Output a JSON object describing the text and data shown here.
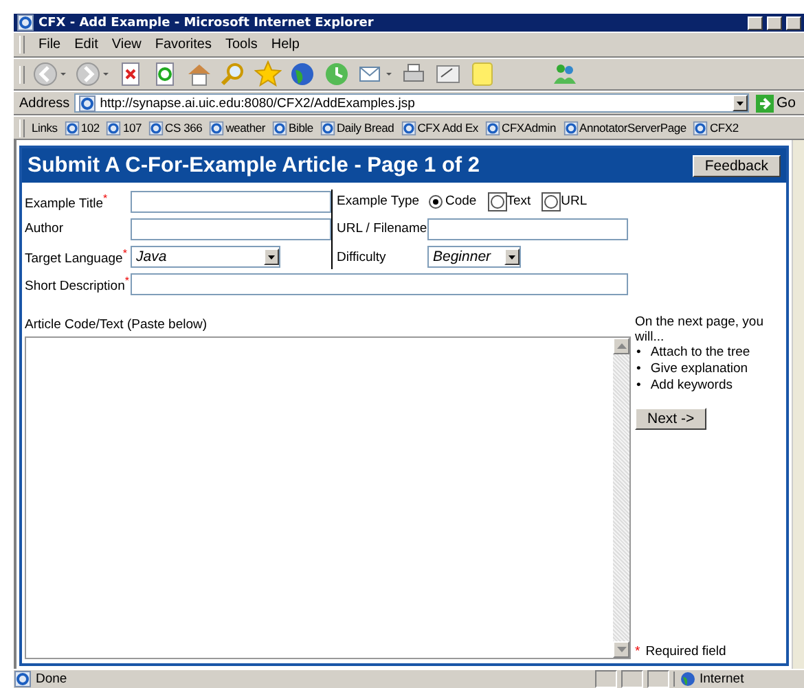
{
  "window": {
    "title": "CFX - Add Example - Microsoft Internet Explorer"
  },
  "menu": [
    "File",
    "Edit",
    "View",
    "Favorites",
    "Tools",
    "Help"
  ],
  "address": {
    "label": "Address",
    "url": "http://synapse.ai.uic.edu:8080/CFX2/AddExamples.jsp",
    "go": "Go"
  },
  "links": {
    "label": "Links",
    "items": [
      "102",
      "107",
      "CS 366",
      "weather",
      "Bible",
      "Daily Bread",
      "CFX Add Ex",
      "CFXAdmin",
      "AnnotatorServerPage",
      "CFX2"
    ]
  },
  "page": {
    "heading": "Submit A C-For-Example Article - Page 1 of 2",
    "feedback": "Feedback"
  },
  "form": {
    "title": {
      "label": "Example Title$^{*}$"
    },
    "author": {
      "label": "Author"
    },
    "language": {
      "label": "Target Language$^{*}$",
      "value": "Java"
    },
    "type": {
      "label": "Example Type",
      "options": [
        {
          "label": "Code",
          "selected": true
        },
        {
          "label": "Text",
          "selected": false
        },
        {
          "label": "URL",
          "selected": false
        }
      ]
    },
    "url": {
      "label": "URL / Filename"
    },
    "difficulty": {
      "label": "Difficulty",
      "value": "Beginner"
    },
    "description": {
      "label": "Short Description$^{*}$"
    },
    "article": {
      "label": "Article Code/Text (Paste below)"
    }
  },
  "sidebar": {
    "intro": "On the next page, you will...",
    "bullet": "•",
    "steps": [
      "Attach to the tree",
      "Give explanation",
      "Add keywords"
    ],
    "next": "Next ->",
    "required": {
      "mark": "*",
      "text": "Required field"
    }
  },
  "status_bar": {
    "text": "Done",
    "zone": "Internet"
  }
}
